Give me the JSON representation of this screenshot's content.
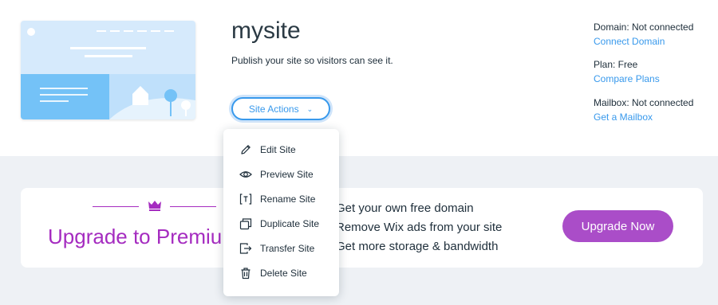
{
  "site": {
    "name": "mysite",
    "subtitle": "Publish your site so visitors can see it.",
    "actions_label": "Site Actions"
  },
  "info": {
    "domain_label": "Domain: Not connected",
    "domain_link": "Connect Domain",
    "plan_label": "Plan: Free",
    "plan_link": "Compare Plans",
    "mailbox_label": "Mailbox: Not connected",
    "mailbox_link": "Get a Mailbox"
  },
  "upgrade": {
    "title": "Upgrade to Premium",
    "benefits": [
      "Get your own free domain",
      "Remove Wix ads from your site",
      "Get more storage & bandwidth"
    ],
    "button_label": "Upgrade Now"
  },
  "menu": {
    "items": [
      {
        "label": "Edit Site",
        "icon": "pencil-icon"
      },
      {
        "label": "Preview Site",
        "icon": "eye-icon"
      },
      {
        "label": "Rename Site",
        "icon": "text-rename-icon"
      },
      {
        "label": "Duplicate Site",
        "icon": "duplicate-icon"
      },
      {
        "label": "Transfer Site",
        "icon": "transfer-icon"
      },
      {
        "label": "Delete Site",
        "icon": "trash-icon"
      }
    ]
  },
  "colors": {
    "accent": "#3899ec",
    "premium": "#a52cc0",
    "upgrade_button": "#aa4dc8",
    "background": "#eef1f5"
  }
}
